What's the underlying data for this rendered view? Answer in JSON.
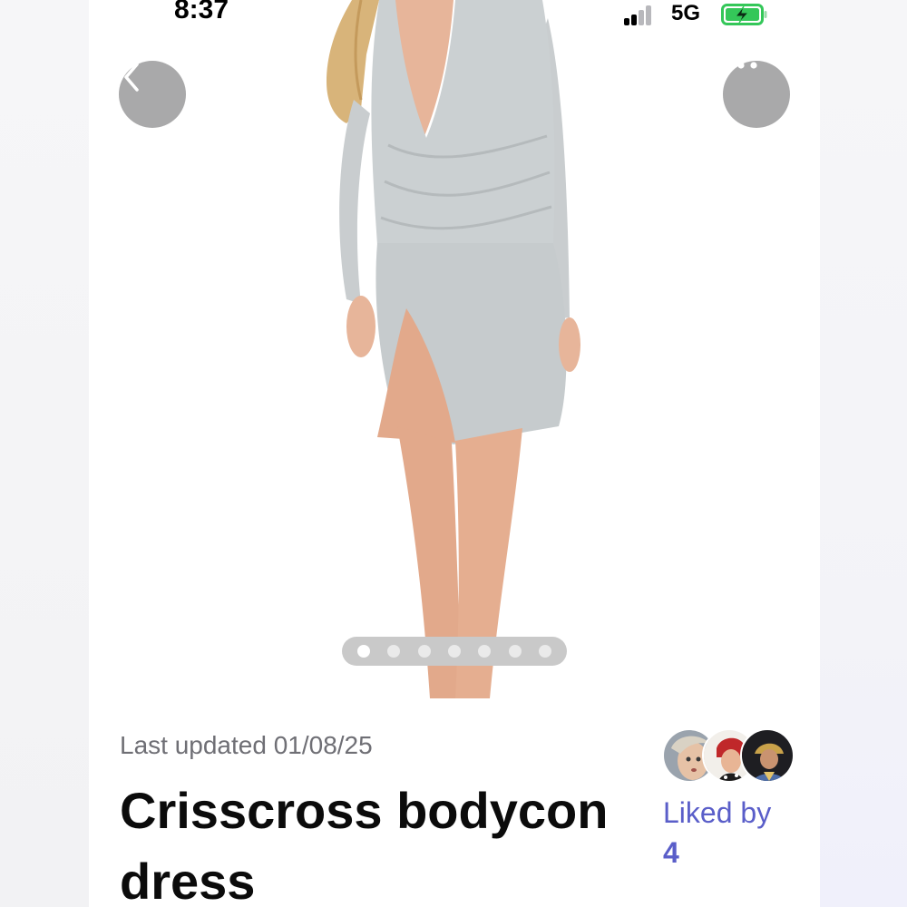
{
  "status_bar": {
    "time": "8:37",
    "network": "5G",
    "signal_bars_filled": 2,
    "signal_bars_total": 4,
    "battery_state": "charging",
    "battery_color": "#34c759"
  },
  "nav": {
    "back_icon": "chevron-left-icon",
    "more_icon": "more-horizontal-icon"
  },
  "gallery": {
    "image_count": 7,
    "active_index": 0
  },
  "listing": {
    "last_updated": "Last updated 01/08/25",
    "title": "Crisscross bodycon dress",
    "liked_by_label": "Liked by",
    "liked_count": "4"
  },
  "colors": {
    "accent": "#5a5ec9",
    "button_bg": "#a9a9aa",
    "dress": "#c9cdcf"
  }
}
